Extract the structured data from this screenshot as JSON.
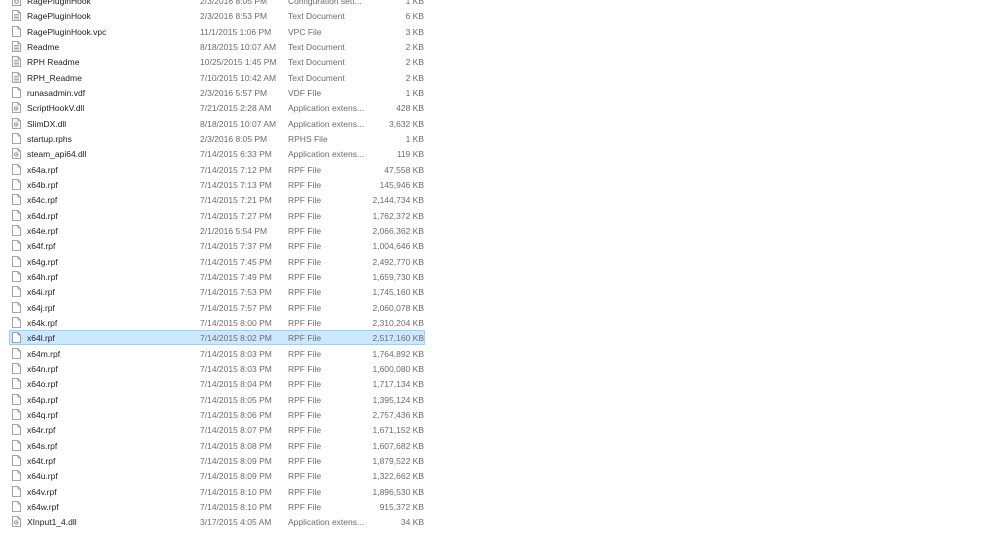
{
  "files": [
    {
      "name": "RagePluginHook",
      "date": "2/3/2016 8:05 PM",
      "type": "Configuration sett...",
      "size": "1 KB",
      "icon": "settings-file-icon"
    },
    {
      "name": "RagePluginHook",
      "date": "2/3/2016 8:53 PM",
      "type": "Text Document",
      "size": "6 KB",
      "icon": "text-file-icon"
    },
    {
      "name": "RagePluginHook.vpc",
      "date": "11/1/2015 1:06 PM",
      "type": "VPC File",
      "size": "3 KB",
      "icon": "file-icon"
    },
    {
      "name": "Readme",
      "date": "8/18/2015 10:07 AM",
      "type": "Text Document",
      "size": "2 KB",
      "icon": "text-file-icon"
    },
    {
      "name": "RPH Readme",
      "date": "10/25/2015 1:45 PM",
      "type": "Text Document",
      "size": "2 KB",
      "icon": "text-file-icon"
    },
    {
      "name": "RPH_Readme",
      "date": "7/10/2015 10:42 AM",
      "type": "Text Document",
      "size": "2 KB",
      "icon": "text-file-icon"
    },
    {
      "name": "runasadmin.vdf",
      "date": "2/3/2016 5:57 PM",
      "type": "VDF File",
      "size": "1 KB",
      "icon": "file-icon"
    },
    {
      "name": "ScriptHookV.dll",
      "date": "7/21/2015 2:28 AM",
      "type": "Application extens...",
      "size": "428 KB",
      "icon": "dll-file-icon"
    },
    {
      "name": "SlimDX.dll",
      "date": "8/18/2015 10:07 AM",
      "type": "Application extens...",
      "size": "3,632 KB",
      "icon": "dll-file-icon"
    },
    {
      "name": "startup.rphs",
      "date": "2/3/2016 8:05 PM",
      "type": "RPHS File",
      "size": "1 KB",
      "icon": "file-icon"
    },
    {
      "name": "steam_api64.dll",
      "date": "7/14/2015 6:33 PM",
      "type": "Application extens...",
      "size": "119 KB",
      "icon": "dll-file-icon"
    },
    {
      "name": "x64a.rpf",
      "date": "7/14/2015 7:12 PM",
      "type": "RPF File",
      "size": "47,558 KB",
      "icon": "file-icon"
    },
    {
      "name": "x64b.rpf",
      "date": "7/14/2015 7:13 PM",
      "type": "RPF File",
      "size": "145,946 KB",
      "icon": "file-icon"
    },
    {
      "name": "x64c.rpf",
      "date": "7/14/2015 7:21 PM",
      "type": "RPF File",
      "size": "2,144,734 KB",
      "icon": "file-icon"
    },
    {
      "name": "x64d.rpf",
      "date": "7/14/2015 7:27 PM",
      "type": "RPF File",
      "size": "1,762,372 KB",
      "icon": "file-icon"
    },
    {
      "name": "x64e.rpf",
      "date": "2/1/2016 5:54 PM",
      "type": "RPF File",
      "size": "2,066,362 KB",
      "icon": "file-icon"
    },
    {
      "name": "x64f.rpf",
      "date": "7/14/2015 7:37 PM",
      "type": "RPF File",
      "size": "1,004,646 KB",
      "icon": "file-icon"
    },
    {
      "name": "x64g.rpf",
      "date": "7/14/2015 7:45 PM",
      "type": "RPF File",
      "size": "2,492,770 KB",
      "icon": "file-icon"
    },
    {
      "name": "x64h.rpf",
      "date": "7/14/2015 7:49 PM",
      "type": "RPF File",
      "size": "1,659,730 KB",
      "icon": "file-icon"
    },
    {
      "name": "x64i.rpf",
      "date": "7/14/2015 7:53 PM",
      "type": "RPF File",
      "size": "1,745,160 KB",
      "icon": "file-icon"
    },
    {
      "name": "x64j.rpf",
      "date": "7/14/2015 7:57 PM",
      "type": "RPF File",
      "size": "2,060,078 KB",
      "icon": "file-icon"
    },
    {
      "name": "x64k.rpf",
      "date": "7/14/2015 8:00 PM",
      "type": "RPF File",
      "size": "2,310,204 KB",
      "icon": "file-icon"
    },
    {
      "name": "x64l.rpf",
      "date": "7/14/2015 8:02 PM",
      "type": "RPF File",
      "size": "2,517,160 KB",
      "icon": "file-icon",
      "selected": true
    },
    {
      "name": "x64m.rpf",
      "date": "7/14/2015 8:03 PM",
      "type": "RPF File",
      "size": "1,764,892 KB",
      "icon": "file-icon"
    },
    {
      "name": "x64n.rpf",
      "date": "7/14/2015 8:03 PM",
      "type": "RPF File",
      "size": "1,600,080 KB",
      "icon": "file-icon"
    },
    {
      "name": "x64o.rpf",
      "date": "7/14/2015 8:04 PM",
      "type": "RPF File",
      "size": "1,717,134 KB",
      "icon": "file-icon"
    },
    {
      "name": "x64p.rpf",
      "date": "7/14/2015 8:05 PM",
      "type": "RPF File",
      "size": "1,395,124 KB",
      "icon": "file-icon"
    },
    {
      "name": "x64q.rpf",
      "date": "7/14/2015 8:06 PM",
      "type": "RPF File",
      "size": "2,757,436 KB",
      "icon": "file-icon"
    },
    {
      "name": "x64r.rpf",
      "date": "7/14/2015 8:07 PM",
      "type": "RPF File",
      "size": "1,671,152 KB",
      "icon": "file-icon"
    },
    {
      "name": "x64s.rpf",
      "date": "7/14/2015 8:08 PM",
      "type": "RPF File",
      "size": "1,607,682 KB",
      "icon": "file-icon"
    },
    {
      "name": "x64t.rpf",
      "date": "7/14/2015 8:09 PM",
      "type": "RPF File",
      "size": "1,879,522 KB",
      "icon": "file-icon"
    },
    {
      "name": "x64u.rpf",
      "date": "7/14/2015 8:09 PM",
      "type": "RPF File",
      "size": "1,322,662 KB",
      "icon": "file-icon"
    },
    {
      "name": "x64v.rpf",
      "date": "7/14/2015 8:10 PM",
      "type": "RPF File",
      "size": "1,896,530 KB",
      "icon": "file-icon"
    },
    {
      "name": "x64w.rpf",
      "date": "7/14/2015 8:10 PM",
      "type": "RPF File",
      "size": "915,372 KB",
      "icon": "file-icon"
    },
    {
      "name": "XInput1_4.dll",
      "date": "3/17/2015 4:05 AM",
      "type": "Application extens...",
      "size": "34 KB",
      "icon": "dll-file-icon"
    }
  ],
  "colors": {
    "selection_bg": "#cce8ff",
    "selection_border": "#99d1ff",
    "secondary_text": "#6d6d6d"
  }
}
